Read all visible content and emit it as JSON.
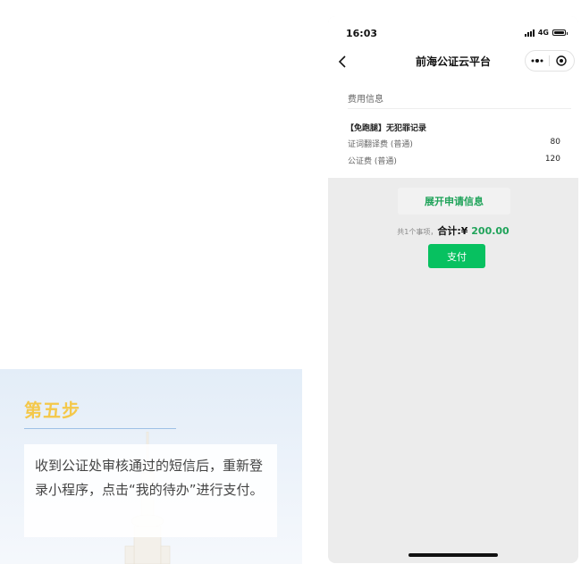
{
  "step": {
    "title": "第五步",
    "description": "收到公证处审核通过的短信后，重新登录小程序，点击“我的待办”进行支付。"
  },
  "phone": {
    "status_bar": {
      "time": "16:03",
      "network": "4G"
    },
    "nav": {
      "title": "前海公证云平台",
      "icons": [
        "back-icon",
        "more-icon",
        "close-capsule-icon"
      ]
    },
    "fee_section": {
      "title": "费用信息",
      "item_title": "【免跑腿】无犯罪记录",
      "fees": [
        {
          "label": "证词翻译费 (普通)",
          "amount": "80"
        },
        {
          "label": "公证费 (普通)",
          "amount": "120"
        }
      ]
    },
    "expand_label": "展开申请信息",
    "summary": {
      "count_text": "共1个事项，",
      "total_label": "合计:¥",
      "total_amount": " 200.00"
    },
    "pay_label": "支付"
  },
  "colors": {
    "accent_green": "#07c160",
    "step_title_gold": "#f4c84a",
    "total_green": "#20a35a"
  }
}
